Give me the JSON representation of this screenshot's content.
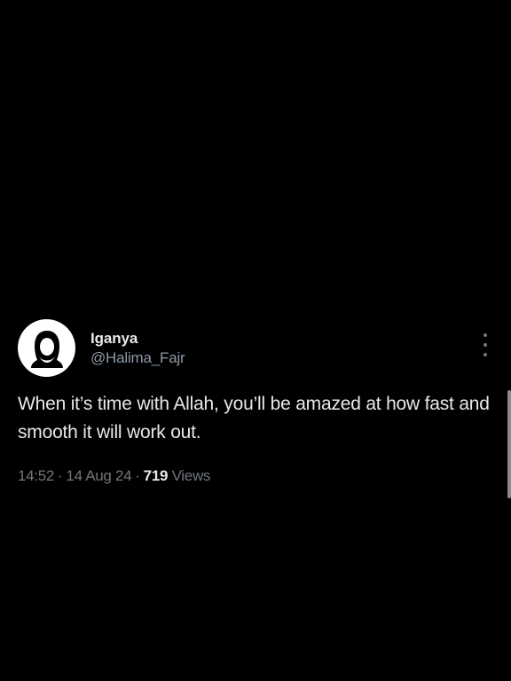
{
  "tweet": {
    "display_name": "Iganya",
    "handle": "@Halima_Fajr",
    "text": "When it’s time with Allah, you’ll be amazed at how fast and smooth it will work out.",
    "time": "14:52",
    "separator": "·",
    "date": "14 Aug 24",
    "views_count": "719",
    "views_label": "Views",
    "avatar_icon": "hijab-woman-avatar-icon",
    "more_icon": "more-options-icon"
  },
  "colors": {
    "background": "#000000",
    "primary_text": "#e7e9ea",
    "secondary_text": "#71767b",
    "avatar_bg": "#ffffff"
  }
}
